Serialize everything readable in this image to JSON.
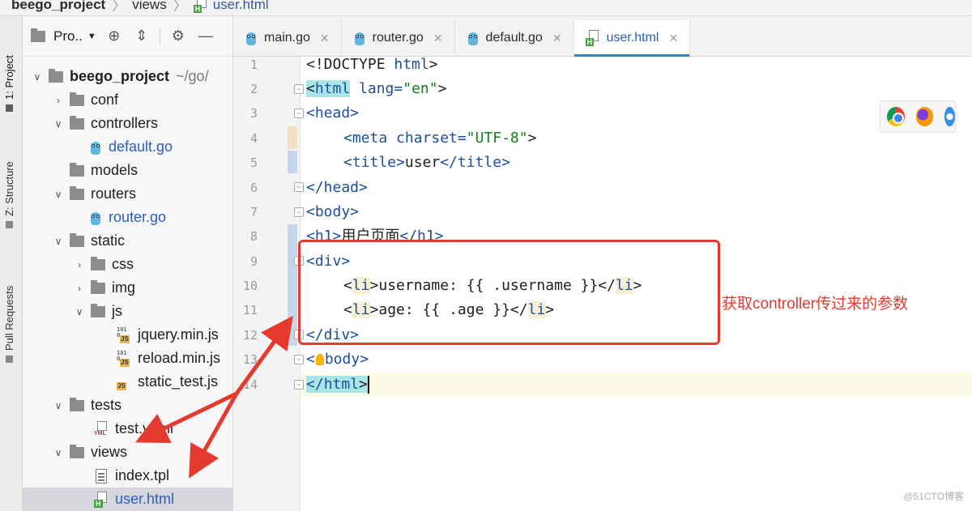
{
  "breadcrumb": {
    "project": "beego_project",
    "folder": "views",
    "file": "user.html"
  },
  "tool_strip": {
    "project_tab": "1: Project",
    "structure_tab": "Z: Structure",
    "pull_requests_tab": "Pull Requests"
  },
  "project_panel": {
    "selector_label": "Pro..",
    "tree": [
      {
        "label": "beego_project",
        "suffix": "~/go/",
        "type": "folder",
        "expanded": true
      },
      {
        "label": "conf",
        "type": "folder",
        "expanded": false
      },
      {
        "label": "controllers",
        "type": "folder",
        "expanded": true
      },
      {
        "label": "default.go",
        "type": "go"
      },
      {
        "label": "models",
        "type": "folder"
      },
      {
        "label": "routers",
        "type": "folder",
        "expanded": true
      },
      {
        "label": "router.go",
        "type": "go"
      },
      {
        "label": "static",
        "type": "folder",
        "expanded": true
      },
      {
        "label": "css",
        "type": "folder",
        "expanded": false
      },
      {
        "label": "img",
        "type": "folder",
        "expanded": false
      },
      {
        "label": "js",
        "type": "folder",
        "expanded": true
      },
      {
        "label": "jquery.min.js",
        "type": "js"
      },
      {
        "label": "reload.min.js",
        "type": "js"
      },
      {
        "label": "static_test.js",
        "type": "js"
      },
      {
        "label": "tests",
        "type": "folder",
        "expanded": true
      },
      {
        "label": "test.yaml",
        "type": "yaml"
      },
      {
        "label": "views",
        "type": "folder",
        "expanded": true
      },
      {
        "label": "index.tpl",
        "type": "tpl"
      },
      {
        "label": "user.html",
        "type": "html",
        "selected": true
      }
    ]
  },
  "editor": {
    "tabs": [
      {
        "label": "main.go",
        "active": false
      },
      {
        "label": "router.go",
        "active": false
      },
      {
        "label": "default.go",
        "active": false
      },
      {
        "label": "user.html",
        "active": true
      }
    ],
    "lines": [
      "1",
      "2",
      "3",
      "4",
      "5",
      "6",
      "7",
      "8",
      "9",
      "10",
      "11",
      "12",
      "13",
      "14"
    ],
    "code": {
      "l1_doctype": "<!DOCTYPE ",
      "l1_html": "html",
      "l1_end": ">",
      "l2_open": "<",
      "l2_tag": "html",
      "l2_attr": " lang=",
      "l2_val": "\"en\"",
      "l2_end": ">",
      "l3": "<head>",
      "l4_open": "<meta ",
      "l4_attr": "charset=",
      "l4_val": "\"UTF-8\"",
      "l4_end": ">",
      "l5_open": "<title>",
      "l5_text": "user",
      "l5_close": "</title>",
      "l6": "</head>",
      "l7": "<body>",
      "l8_open": "<h1>",
      "l8_text": "用户页面",
      "l8_close": "</h1>",
      "l9": "<div>",
      "l10_open": "<",
      "l10_tag": "li",
      "l10_mid": ">username: {{ .username }}</",
      "l10_tag2": "li",
      "l10_end": ">",
      "l11_open": "<",
      "l11_tag": "li",
      "l11_mid": ">age: {{ .age }}</",
      "l11_tag2": "li",
      "l11_end": ">",
      "l12": "</div>",
      "l13_a": "<",
      "l13_b": "body>",
      "l14_open": "</",
      "l14_tag": "html",
      "l14_end": ">"
    }
  },
  "annotation": {
    "text": "获取controller传过来的参数",
    "color": "#e53a2f"
  },
  "watermark": "@51CTO博客"
}
